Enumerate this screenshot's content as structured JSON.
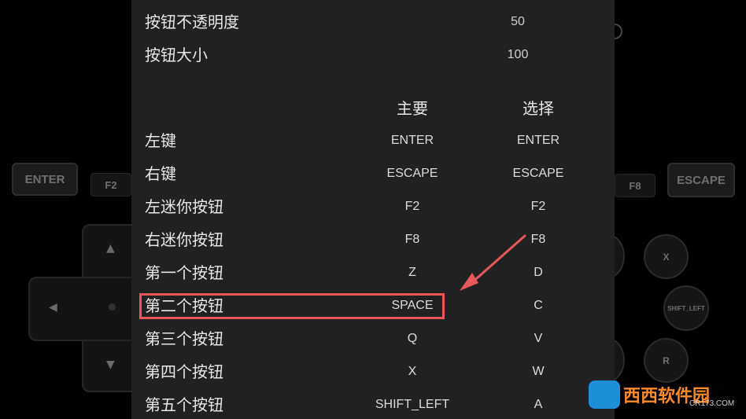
{
  "background_controls": {
    "enter": "ENTER",
    "f2": "F2",
    "escape": "ESCAPE",
    "f8": "F8",
    "x": "X",
    "shift_left": "SHIFT_LEFT",
    "r": "R"
  },
  "settings": {
    "opacity": {
      "label": "按钮不透明度",
      "value": "50"
    },
    "size": {
      "label": "按钮大小",
      "value": "100"
    },
    "headers": {
      "primary": "主要",
      "secondary": "选择"
    },
    "rows": [
      {
        "label": "左键",
        "primary": "ENTER",
        "secondary": "ENTER"
      },
      {
        "label": "右键",
        "primary": "ESCAPE",
        "secondary": "ESCAPE"
      },
      {
        "label": "左迷你按钮",
        "primary": "F2",
        "secondary": "F2"
      },
      {
        "label": "右迷你按钮",
        "primary": "F8",
        "secondary": "F8"
      },
      {
        "label": "第一个按钮",
        "primary": "Z",
        "secondary": "D"
      },
      {
        "label": "第二个按钮",
        "primary": "SPACE",
        "secondary": "C"
      },
      {
        "label": "第三个按钮",
        "primary": "Q",
        "secondary": "V"
      },
      {
        "label": "第四个按钮",
        "primary": "X",
        "secondary": "W"
      },
      {
        "label": "第五个按钮",
        "primary": "SHIFT_LEFT",
        "secondary": "A"
      }
    ]
  },
  "annotation": {
    "highlight_color": "#e9575b"
  },
  "watermark": {
    "brand": "西西软件园",
    "url": "CR173.COM"
  }
}
